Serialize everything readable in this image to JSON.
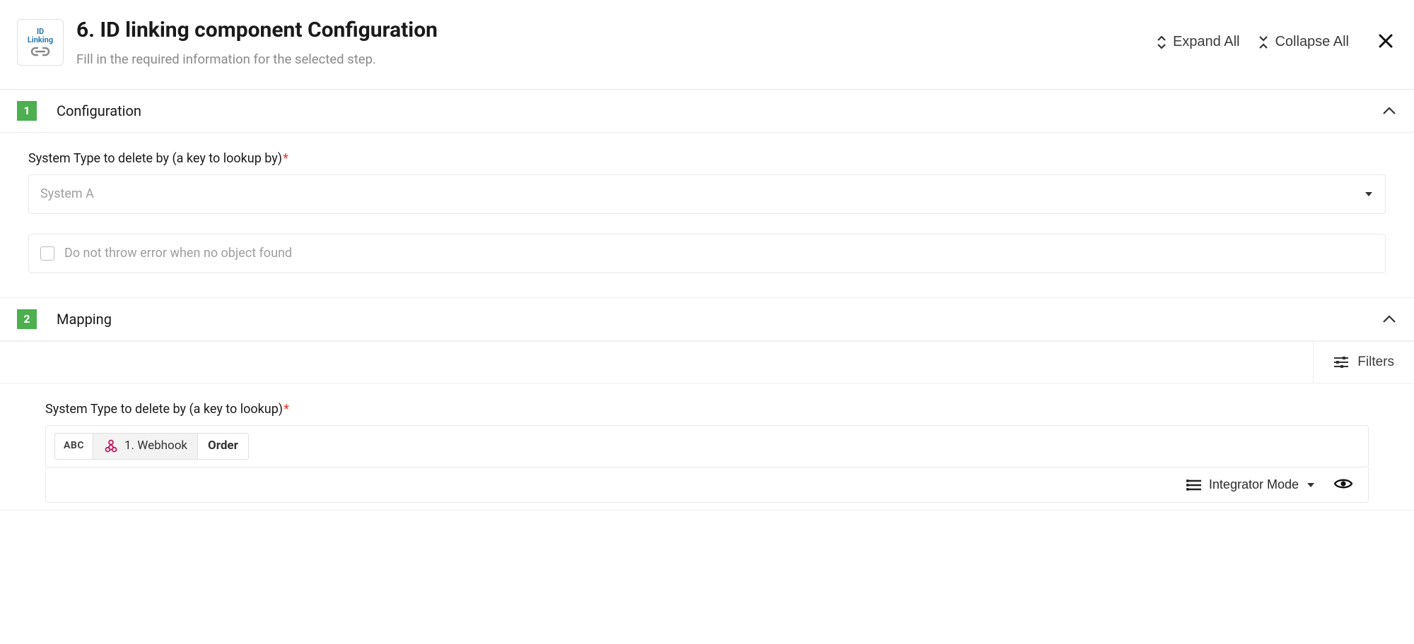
{
  "header": {
    "icon": {
      "line1": "ID",
      "line2": "Linking"
    },
    "title": "6. ID linking component Configuration",
    "subtitle": "Fill in the required information for the selected step.",
    "expand_all": "Expand All",
    "collapse_all": "Collapse All"
  },
  "sections": {
    "config": {
      "num": "1",
      "title": "Configuration",
      "field_label": "System Type to delete by (a key to lookup by)",
      "dropdown_value": "System A",
      "checkbox_label": "Do not throw error when no object found"
    },
    "mapping": {
      "num": "2",
      "title": "Mapping",
      "filters_label": "Filters",
      "field_label": "System Type to delete by (a key to lookup)",
      "chip_prefix": "ABC",
      "chip_source": "1. Webhook",
      "chip_value": "Order",
      "mode_label": "Integrator Mode"
    }
  }
}
